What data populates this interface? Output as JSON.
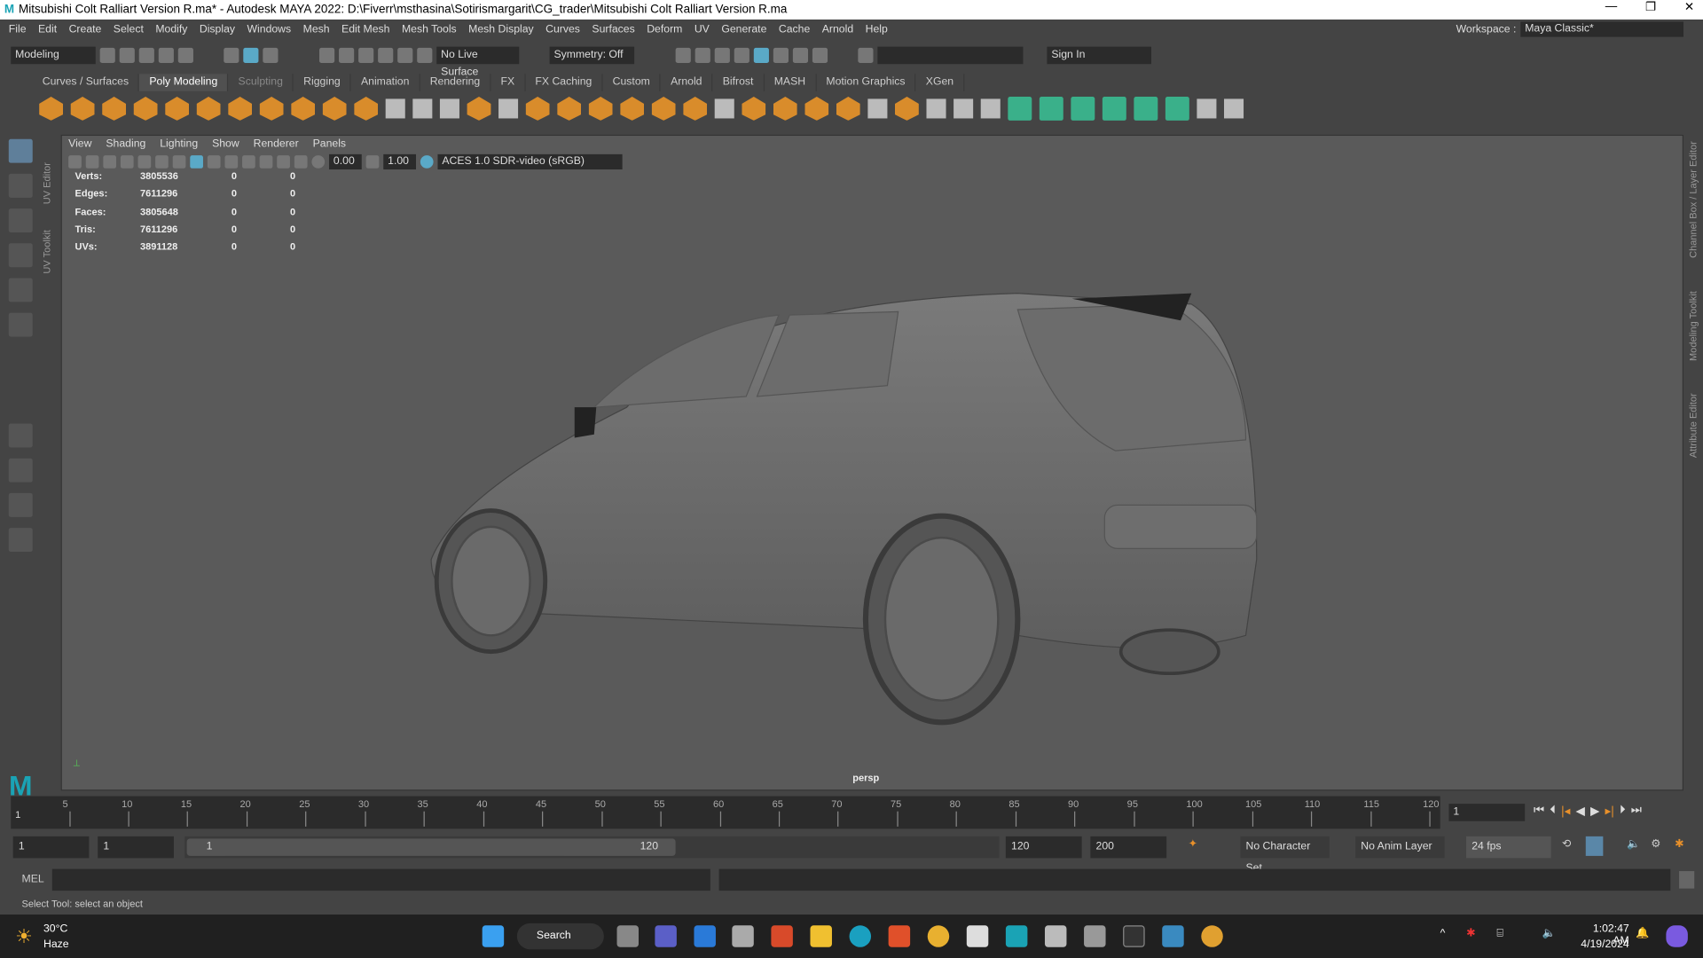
{
  "window": {
    "title": "Mitsubishi Colt Ralliart Version R.ma* - Autodesk MAYA 2022: D:\\Fiverr\\msthasina\\Sotirismargarit\\CG_trader\\Mitsubishi Colt Ralliart Version R.ma",
    "logo": "M",
    "min": "—",
    "max": "❐",
    "close": "✕"
  },
  "menu": [
    "File",
    "Edit",
    "Create",
    "Select",
    "Modify",
    "Display",
    "Windows",
    "Mesh",
    "Edit Mesh",
    "Mesh Tools",
    "Mesh Display",
    "Curves",
    "Surfaces",
    "Deform",
    "UV",
    "Generate",
    "Cache",
    "Arnold",
    "Help"
  ],
  "workspace": {
    "label": "Workspace :",
    "value": "Maya Classic*"
  },
  "toolbar": {
    "mode": "Modeling",
    "live_surface": "No Live Surface",
    "symmetry": "Symmetry: Off",
    "sign_in": "Sign In"
  },
  "shelf_tabs": [
    "Curves / Surfaces",
    "Poly Modeling",
    "Sculpting",
    "Rigging",
    "Animation",
    "Rendering",
    "FX",
    "FX Caching",
    "Custom",
    "Arnold",
    "Bifrost",
    "MASH",
    "Motion Graphics",
    "XGen"
  ],
  "active_shelf": "Poly Modeling",
  "left_side_tabs": [
    "UV Editor",
    "UV Toolkit"
  ],
  "right_side_tabs": [
    "Channel Box / Layer Editor",
    "Modeling Toolkit",
    "Attribute Editor"
  ],
  "viewport": {
    "menu": [
      "View",
      "Shading",
      "Lighting",
      "Show",
      "Renderer",
      "Panels"
    ],
    "exposure": "0.00",
    "gamma": "1.00",
    "colorspace": "ACES 1.0 SDR-video (sRGB)",
    "camera": "persp",
    "hud": [
      [
        "Verts:",
        "3805536",
        "0",
        "0"
      ],
      [
        "Edges:",
        "7611296",
        "0",
        "0"
      ],
      [
        "Faces:",
        "3805648",
        "0",
        "0"
      ],
      [
        "Tris:",
        "7611296",
        "0",
        "0"
      ],
      [
        "UVs:",
        "3891128",
        "0",
        "0"
      ]
    ]
  },
  "timeline": {
    "ticks": [
      "5",
      "10",
      "15",
      "20",
      "25",
      "30",
      "35",
      "40",
      "45",
      "50",
      "55",
      "60",
      "65",
      "70",
      "75",
      "80",
      "85",
      "90",
      "95",
      "100",
      "105",
      "110",
      "115",
      "120"
    ],
    "start_label": "1",
    "current": "1",
    "min": 120
  },
  "range": {
    "start": "1",
    "playback_start": "1",
    "slider_start": "1",
    "slider_end": "120",
    "playback_end": "120",
    "end": "200",
    "character_set": "No Character Set",
    "anim_layer": "No Anim Layer",
    "fps": "24 fps"
  },
  "command": {
    "lang": "MEL"
  },
  "status": "Select Tool: select an object",
  "taskbar": {
    "weather_temp": "30°C",
    "weather_desc": "Haze",
    "search": "Search",
    "time": "1:02:47 AM",
    "date": "4/19/2024"
  }
}
